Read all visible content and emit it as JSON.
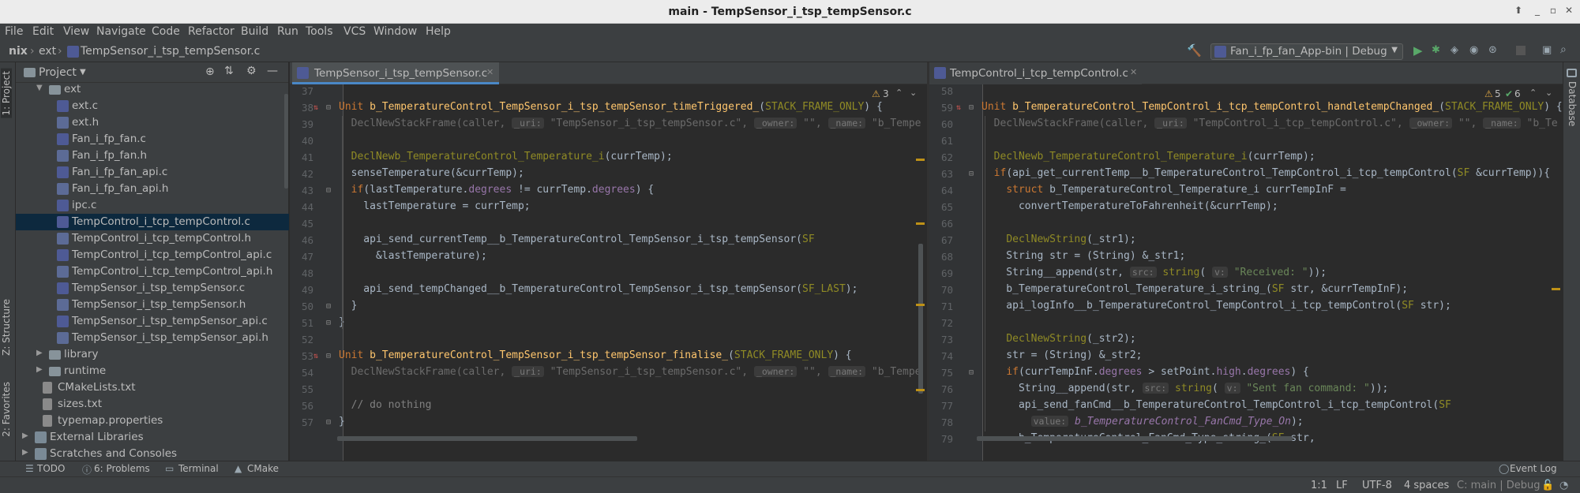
{
  "window": {
    "title": "main - TempSensor_i_tsp_tempSensor.c"
  },
  "menu": [
    "File",
    "Edit",
    "View",
    "Navigate",
    "Code",
    "Refactor",
    "Build",
    "Run",
    "Tools",
    "VCS",
    "Window",
    "Help"
  ],
  "breadcrumb": {
    "root": "nix",
    "folder": "ext",
    "file": "TempSensor_i_tsp_tempSensor.c"
  },
  "run_config": {
    "label": "Fan_i_fp_fan_App-bin | Debug"
  },
  "left_strip": {
    "project": "1: Project",
    "structure": "Z: Structure",
    "favorites": "2: Favorites"
  },
  "right_strip": {
    "database": "Database"
  },
  "project_panel": {
    "title": "Project",
    "items": [
      {
        "label": "ext",
        "kind": "folder",
        "indent": 1,
        "open": true
      },
      {
        "label": "ext.c",
        "kind": "c",
        "indent": 2
      },
      {
        "label": "ext.h",
        "kind": "h",
        "indent": 2
      },
      {
        "label": "Fan_i_fp_fan.c",
        "kind": "c",
        "indent": 2
      },
      {
        "label": "Fan_i_fp_fan.h",
        "kind": "h",
        "indent": 2
      },
      {
        "label": "Fan_i_fp_fan_api.c",
        "kind": "c",
        "indent": 2
      },
      {
        "label": "Fan_i_fp_fan_api.h",
        "kind": "h",
        "indent": 2
      },
      {
        "label": "ipc.c",
        "kind": "c",
        "indent": 2
      },
      {
        "label": "TempControl_i_tcp_tempControl.c",
        "kind": "c",
        "indent": 2,
        "selected": true
      },
      {
        "label": "TempControl_i_tcp_tempControl.h",
        "kind": "h",
        "indent": 2
      },
      {
        "label": "TempControl_i_tcp_tempControl_api.c",
        "kind": "c",
        "indent": 2
      },
      {
        "label": "TempControl_i_tcp_tempControl_api.h",
        "kind": "h",
        "indent": 2
      },
      {
        "label": "TempSensor_i_tsp_tempSensor.c",
        "kind": "c",
        "indent": 2
      },
      {
        "label": "TempSensor_i_tsp_tempSensor.h",
        "kind": "h",
        "indent": 2
      },
      {
        "label": "TempSensor_i_tsp_tempSensor_api.c",
        "kind": "c",
        "indent": 2
      },
      {
        "label": "TempSensor_i_tsp_tempSensor_api.h",
        "kind": "h",
        "indent": 2
      },
      {
        "label": "library",
        "kind": "folder",
        "indent": 1,
        "open": false
      },
      {
        "label": "runtime",
        "kind": "folder",
        "indent": 1,
        "open": false
      },
      {
        "label": "CMakeLists.txt",
        "kind": "txt",
        "indent": 1
      },
      {
        "label": "sizes.txt",
        "kind": "txt",
        "indent": 1
      },
      {
        "label": "typemap.properties",
        "kind": "txt",
        "indent": 1
      },
      {
        "label": "External Libraries",
        "kind": "lib",
        "indent": 0,
        "open": false
      },
      {
        "label": "Scratches and Consoles",
        "kind": "lib",
        "indent": 0,
        "open": false
      }
    ]
  },
  "editor_left": {
    "tab": "TempSensor_i_tsp_tempSensor.c",
    "warnings": "3",
    "lines": [
      {
        "n": "37",
        "html": ""
      },
      {
        "n": "38",
        "html": "<span class='kw'>Unit </span><span class='fn'>b_TemperatureControl_TempSensor_i_tsp_tempSensor_timeTriggered_</span>(<span class='mac'>STACK_FRAME_ONLY</span>) {"
      },
      {
        "n": "39",
        "html": "  <span class='dim'>DeclNewStackFrame(caller, <span class='hint'>_uri:</span> \"TempSensor_i_tsp_tempSensor.c\", <span class='hint'>_owner:</span> \"\", <span class='hint'>_name:</span> \"b_Tempe</span>"
      },
      {
        "n": "40",
        "html": ""
      },
      {
        "n": "41",
        "html": "  <span class='mac'>DeclNewb_TemperatureControl_Temperature_i</span>(currTemp);"
      },
      {
        "n": "42",
        "html": "  senseTemperature(&amp;currTemp);"
      },
      {
        "n": "43",
        "html": "  <span class='kw'>if</span>(lastTemperature.<span class='fld'>degrees</span> != currTemp.<span class='fld'>degrees</span>) {"
      },
      {
        "n": "44",
        "html": "    lastTemperature = currTemp;"
      },
      {
        "n": "45",
        "html": ""
      },
      {
        "n": "46",
        "html": "    api_send_currentTemp__b_TemperatureControl_TempSensor_i_tsp_tempSensor(<span class='mac'>SF</span>"
      },
      {
        "n": "47",
        "html": "      &amp;lastTemperature);"
      },
      {
        "n": "48",
        "html": ""
      },
      {
        "n": "49",
        "html": "    api_send_tempChanged__b_TemperatureControl_TempSensor_i_tsp_tempSensor(<span class='mac'>SF_LAST</span>);"
      },
      {
        "n": "50",
        "html": "  }"
      },
      {
        "n": "51",
        "html": "}"
      },
      {
        "n": "52",
        "html": ""
      },
      {
        "n": "53",
        "html": "<span class='kw'>Unit </span><span class='fn'>b_TemperatureControl_TempSensor_i_tsp_tempSensor_finalise_</span>(<span class='mac'>STACK_FRAME_ONLY</span>) {"
      },
      {
        "n": "54",
        "html": "  <span class='dim'>DeclNewStackFrame(caller, <span class='hint'>_uri:</span> \"TempSensor_i_tsp_tempSensor.c\", <span class='hint'>_owner:</span> \"\", <span class='hint'>_name:</span> \"b_Tempe</span>"
      },
      {
        "n": "55",
        "html": ""
      },
      {
        "n": "56",
        "html": "  <span class='cmt'>// do nothing</span>"
      },
      {
        "n": "57",
        "html": "}"
      }
    ]
  },
  "editor_right": {
    "tab": "TempControl_i_tcp_tempControl.c",
    "warnings": "5",
    "checks": "6",
    "lines": [
      {
        "n": "58",
        "html": ""
      },
      {
        "n": "59",
        "html": "<span class='kw'>Unit </span><span class='fn'>b_TemperatureControl_TempControl_i_tcp_tempControl_handletempChanged_</span>(<span class='mac'>STACK_FRAME_ONLY</span>) {"
      },
      {
        "n": "60",
        "html": "  <span class='dim'>DeclNewStackFrame(caller, <span class='hint'>_uri:</span> \"TempControl_i_tcp_tempControl.c\", <span class='hint'>_owner:</span> \"\", <span class='hint'>_name:</span> \"b_Te</span>"
      },
      {
        "n": "61",
        "html": ""
      },
      {
        "n": "62",
        "html": "  <span class='mac'>DeclNewb_TemperatureControl_Temperature_i</span>(currTemp);"
      },
      {
        "n": "63",
        "html": "  <span class='kw'>if</span>(api_get_currentTemp__b_TemperatureControl_TempControl_i_tcp_tempControl(<span class='mac'>SF</span> &amp;currTemp)){"
      },
      {
        "n": "64",
        "html": "    <span class='kw'>struct </span>b_TemperatureControl_Temperature_i currTempInF ="
      },
      {
        "n": "65",
        "html": "      convertTemperatureToFahrenheit(&amp;currTemp);"
      },
      {
        "n": "66",
        "html": ""
      },
      {
        "n": "67",
        "html": "    <span class='mac'>DeclNewString</span>(_str1);"
      },
      {
        "n": "68",
        "html": "    String str = (String) &amp;_str1;"
      },
      {
        "n": "69",
        "html": "    String__append(str, <span class='hint'>src:</span> <span class='mac'>string</span>( <span class='hint'>v:</span> <span class='str'>\"Received: \"</span>));"
      },
      {
        "n": "70",
        "html": "    b_TemperatureControl_Temperature_i_string_(<span class='mac'>SF</span> str, &amp;currTempInF);"
      },
      {
        "n": "71",
        "html": "    api_logInfo__b_TemperatureControl_TempControl_i_tcp_tempControl(<span class='mac'>SF</span> str);"
      },
      {
        "n": "72",
        "html": ""
      },
      {
        "n": "73",
        "html": "    <span class='mac'>DeclNewString</span>(_str2);"
      },
      {
        "n": "74",
        "html": "    str = (String) &amp;_str2;"
      },
      {
        "n": "75",
        "html": "    <span class='kw'>if</span>(currTempInF.<span class='fld'>degrees</span> &gt; setPoint.<span class='fld'>high</span>.<span class='fld'>degrees</span>) {"
      },
      {
        "n": "76",
        "html": "      String__append(str, <span class='hint'>src:</span> <span class='mac'>string</span>( <span class='hint'>v:</span> <span class='str'>\"Sent fan command: \"</span>));"
      },
      {
        "n": "77",
        "html": "      api_send_fanCmd__b_TemperatureControl_TempControl_i_tcp_tempControl(<span class='mac'>SF</span>"
      },
      {
        "n": "78",
        "html": "        <span class='hint'>value:</span> <span class='fld it'>b_TemperatureControl_FanCmd_Type_On</span>);"
      },
      {
        "n": "79",
        "html": "      b_TemperatureControl_FanCmd_Type_string_(<span class='mac'>SF</span> str,"
      }
    ]
  },
  "bottom_tools": [
    "TODO",
    "6: Problems",
    "Terminal",
    "CMake"
  ],
  "event_log": "Event Log",
  "status": {
    "position": "1:1",
    "line_sep": "LF",
    "encoding": "UTF-8",
    "indent": "4 spaces",
    "context": "C: main | Debug"
  },
  "colors": {
    "bg": "#2b2b2b",
    "panel": "#3c3f41",
    "selection": "#0d293e",
    "tab_underline": "#4a88c7",
    "keyword": "#cc7832",
    "function": "#ffc66d"
  }
}
